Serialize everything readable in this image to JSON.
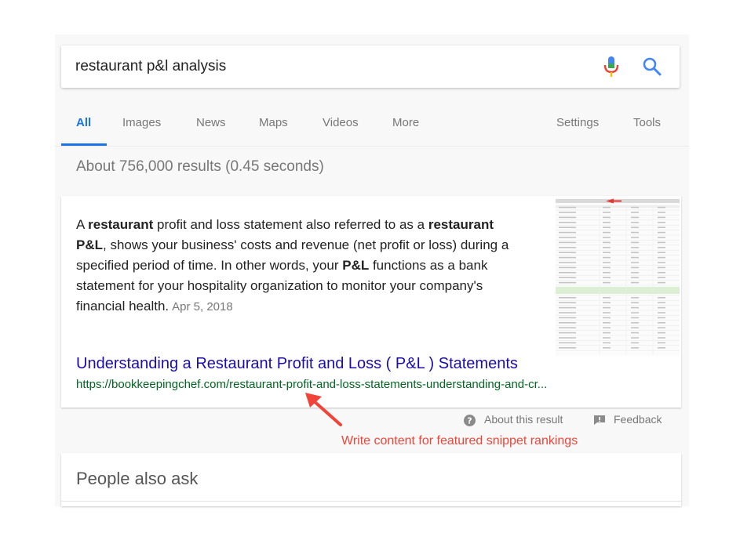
{
  "search": {
    "query": "restaurant p&l analysis"
  },
  "tabs": [
    {
      "label": "All"
    },
    {
      "label": "Images"
    },
    {
      "label": "News"
    },
    {
      "label": "Maps"
    },
    {
      "label": "Videos"
    },
    {
      "label": "More"
    },
    {
      "label": "Settings"
    },
    {
      "label": "Tools"
    }
  ],
  "result_stats": "About 756,000 results (0.45 seconds)",
  "snippet": {
    "parts": [
      {
        "text": "A ",
        "bold": false
      },
      {
        "text": "restaurant",
        "bold": true
      },
      {
        "text": " profit and loss statement also referred to as a ",
        "bold": false
      },
      {
        "text": "restaurant P&L",
        "bold": true
      },
      {
        "text": ", shows your business' costs and revenue (net profit or loss) during a specified period of time. In other words, your ",
        "bold": false
      },
      {
        "text": "P&L",
        "bold": true
      },
      {
        "text": " functions as a bank statement for your hospitality organization to monitor your company's financial health.",
        "bold": false
      }
    ],
    "date": "Apr 5, 2018",
    "title": "Understanding a Restaurant Profit and Loss ( P&L ) Statements",
    "url": "https://bookkeepingchef.com/restaurant-profit-and-loss-statements-understanding-and-cr..."
  },
  "about_label": "About this result",
  "feedback_label": "Feedback",
  "annotation": "Write content for featured snippet rankings",
  "people_also_ask": {
    "title": "People also ask"
  },
  "colors": {
    "accent": "#1a73e8",
    "link": "#1a0dab",
    "url": "#006621",
    "annotation": "#f04438"
  }
}
